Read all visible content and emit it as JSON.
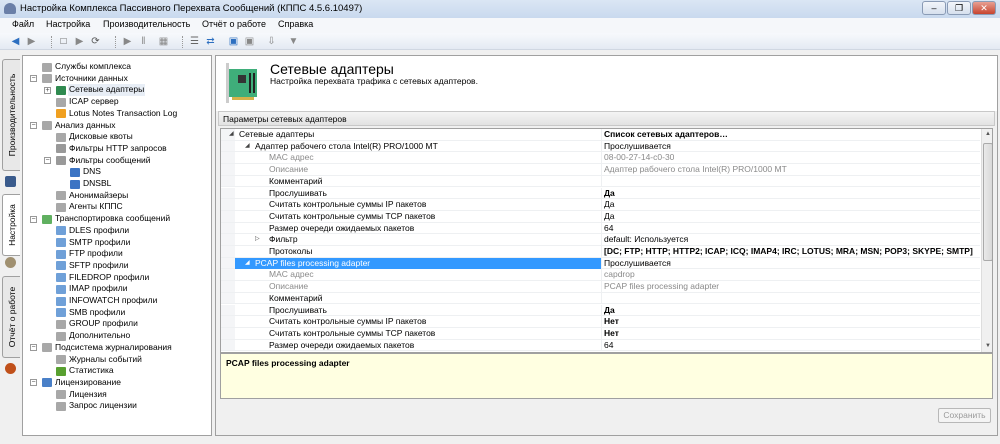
{
  "window": {
    "title": "Настройка Комплекса Пассивного Перехвата Сообщений (КППС 4.5.6.10497)",
    "controls": [
      "–",
      "❐",
      "✕"
    ]
  },
  "menu": [
    "Файл",
    "Настройка",
    "Производительность",
    "Отчёт о работе",
    "Справка"
  ],
  "toolbar": [
    "back-icon",
    "forward-icon",
    "stop-icon",
    "play-icon",
    "restart-icon",
    "start-icon",
    "pause-icon",
    "grid-icon",
    "document-icon",
    "refresh-dropdown-icon",
    "save-icon",
    "save-disabled-icon",
    "import-icon",
    "filter-icon"
  ],
  "vtabs": [
    "Производительность",
    "Настройка",
    "Отчёт о работе"
  ],
  "tree": [
    {
      "label": "Службы комплекса",
      "level": 0,
      "icon": "services-icon"
    },
    {
      "label": "Источники данных",
      "level": 0,
      "icon": "data-sources-icon",
      "expander": "−"
    },
    {
      "label": "Сетевые адаптеры",
      "level": 1,
      "icon": "network-card-icon",
      "expander": "+",
      "selected": true
    },
    {
      "label": "ICAP сервер",
      "level": 1,
      "icon": "server-icon"
    },
    {
      "label": "Lotus Notes Transaction Log",
      "level": 1,
      "icon": "lotus-icon"
    },
    {
      "label": "Анализ данных",
      "level": 0,
      "icon": "analysis-icon",
      "expander": "−"
    },
    {
      "label": "Дисковые квоты",
      "level": 1,
      "icon": "disk-icon"
    },
    {
      "label": "Фильтры HTTP запросов",
      "level": 1,
      "icon": "filter-icon"
    },
    {
      "label": "Фильтры сообщений",
      "level": 1,
      "icon": "filter-icon",
      "expander": "−"
    },
    {
      "label": "DNS",
      "level": 2,
      "icon": "globe-icon"
    },
    {
      "label": "DNSBL",
      "level": 2,
      "icon": "globe-icon"
    },
    {
      "label": "Анонимайзеры",
      "level": 1,
      "icon": "anonymizer-icon"
    },
    {
      "label": "Агенты КППС",
      "level": 1,
      "icon": "agent-icon"
    },
    {
      "label": "Транспортировка сообщений",
      "level": 0,
      "icon": "transport-icon",
      "expander": "−"
    },
    {
      "label": "DLES профили",
      "level": 1,
      "icon": "mail-profile-icon"
    },
    {
      "label": "SMTP профили",
      "level": 1,
      "icon": "mail-profile-icon"
    },
    {
      "label": "FTP профили",
      "level": 1,
      "icon": "mail-profile-icon"
    },
    {
      "label": "SFTP профили",
      "level": 1,
      "icon": "mail-profile-icon"
    },
    {
      "label": "FILEDROP профили",
      "level": 1,
      "icon": "mail-profile-icon"
    },
    {
      "label": "IMAP профили",
      "level": 1,
      "icon": "mail-profile-icon"
    },
    {
      "label": "INFOWATCH профили",
      "level": 1,
      "icon": "mail-profile-icon"
    },
    {
      "label": "SMB профили",
      "level": 1,
      "icon": "mail-profile-icon"
    },
    {
      "label": "GROUP профили",
      "level": 1,
      "icon": "group-icon"
    },
    {
      "label": "Дополнительно",
      "level": 1,
      "icon": "extra-icon"
    },
    {
      "label": "Подсистема журналирования",
      "level": 0,
      "icon": "logging-icon",
      "expander": "−"
    },
    {
      "label": "Журналы событий",
      "level": 1,
      "icon": "log-icon"
    },
    {
      "label": "Статистика",
      "level": 1,
      "icon": "chart-icon"
    },
    {
      "label": "Лицензирование",
      "level": 0,
      "icon": "license-icon",
      "expander": "−"
    },
    {
      "label": "Лицензия",
      "level": 1,
      "icon": "certificate-icon"
    },
    {
      "label": "Запрос лицензии",
      "level": 1,
      "icon": "request-icon"
    }
  ],
  "header": {
    "title": "Сетевые адаптеры",
    "subtitle": "Настройка перехвата трафика с сетевых адаптеров."
  },
  "group_title": "Параметры сетевых адаптеров",
  "grid": [
    {
      "name": "Сетевые адаптеры",
      "value": "Список сетевых адаптеров…",
      "level": 0,
      "expander": "◢",
      "vstyle": "b"
    },
    {
      "name": "Адаптер рабочего стола Intel(R) PRO/1000 MT",
      "value": "Прослушивается",
      "level": 1,
      "expander": "◢"
    },
    {
      "name": "MAC адрес",
      "value": "08-00-27-14-c0-30",
      "level": 2,
      "nstyle": "gray",
      "vstyle": "gray"
    },
    {
      "name": "Описание",
      "value": "Адаптер рабочего стола Intel(R) PRO/1000 MT",
      "level": 2,
      "nstyle": "gray",
      "vstyle": "gray"
    },
    {
      "name": "Комментарий",
      "value": "",
      "level": 2
    },
    {
      "name": "Прослушивать",
      "value": "Да",
      "level": 2,
      "vstyle": "b"
    },
    {
      "name": "Считать контрольные суммы IP пакетов",
      "value": "Да",
      "level": 2
    },
    {
      "name": "Считать контрольные суммы TCP пакетов",
      "value": "Да",
      "level": 2
    },
    {
      "name": "Размер очереди ожидаемых пакетов",
      "value": "64",
      "level": 2
    },
    {
      "name": "Фильтр",
      "value": "default: Используется",
      "level": 2,
      "expander": "▷"
    },
    {
      "name": "Протоколы",
      "value": "[DC; FTP; HTTP; HTTP2; ICAP; ICQ; IMAP4; IRC; LOTUS; MRA; MSN; POP3; SKYPE; SMTP]",
      "level": 2,
      "vstyle": "b"
    },
    {
      "name": "PCAP files processing adapter",
      "value": "Прослушивается",
      "level": 1,
      "expander": "◢",
      "selected": true
    },
    {
      "name": "MAC адрес",
      "value": "capdrop",
      "level": 2,
      "nstyle": "gray",
      "vstyle": "gray"
    },
    {
      "name": "Описание",
      "value": "PCAP files processing adapter",
      "level": 2,
      "nstyle": "gray",
      "vstyle": "gray"
    },
    {
      "name": "Комментарий",
      "value": "",
      "level": 2
    },
    {
      "name": "Прослушивать",
      "value": "Да",
      "level": 2,
      "vstyle": "b"
    },
    {
      "name": "Считать контрольные суммы IP пакетов",
      "value": "Нет",
      "level": 2,
      "vstyle": "b"
    },
    {
      "name": "Считать контрольные суммы TCP пакетов",
      "value": "Нет",
      "level": 2,
      "vstyle": "b"
    },
    {
      "name": "Размер очереди ожидаемых пакетов",
      "value": "64",
      "level": 2
    }
  ],
  "description": "PCAP files processing adapter",
  "save_label": "Сохранить",
  "colors": {
    "selection": "#3399ff",
    "description_bg": "#ffffe1"
  }
}
